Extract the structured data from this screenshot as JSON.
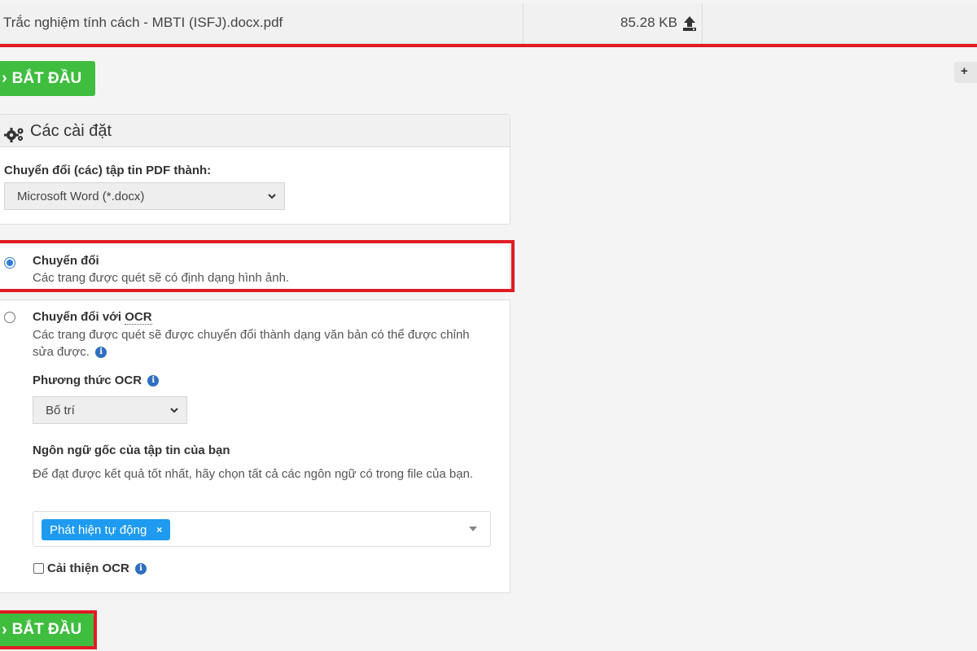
{
  "file": {
    "name": "Trắc nghiệm tính cách - MBTI (ISFJ).docx.pdf",
    "size": "85.28 KB"
  },
  "start_button": {
    "label": "BẮT ĐẦU"
  },
  "add_button": {
    "label": "+"
  },
  "settings": {
    "title": "Các cài đặt",
    "convert_label": "Chuyển đổi (các) tập tin PDF thành:",
    "format_selected": "Microsoft Word (*.docx)"
  },
  "options": {
    "convert": {
      "title": "Chuyển đổi",
      "desc": "Các trang được quét sẽ có định dạng hình ảnh.",
      "checked": true
    },
    "convert_ocr": {
      "title_prefix": "Chuyển đổi với ",
      "title_abbr": "OCR",
      "desc": "Các trang được quét sẽ được chuyển đổi thành dạng văn bản có thể được chỉnh sửa được.",
      "checked": false,
      "method_label": "Phương thức OCR",
      "method_selected": "Bố trí",
      "language_label": "Ngôn ngữ gốc của tập tin của bạn",
      "language_hint": "Để đạt được kết quả tốt nhất, hãy chọn tất cả các ngôn ngữ có trong file của bạn.",
      "language_tag": "Phát hiện tự động",
      "language_tag_remove": "×",
      "improve_label": "Cải thiện OCR"
    }
  },
  "colors": {
    "start_green": "#3fbd3f",
    "highlight_red": "#e01b24",
    "tag_blue": "#1e9bf0",
    "radio_blue": "#2f7fd8"
  },
  "icons": {
    "upload": "upload-icon",
    "gears": "gears-icon",
    "chevron": "chevron-right-icon",
    "info": "info-icon",
    "caret": "chevron-down-icon"
  }
}
